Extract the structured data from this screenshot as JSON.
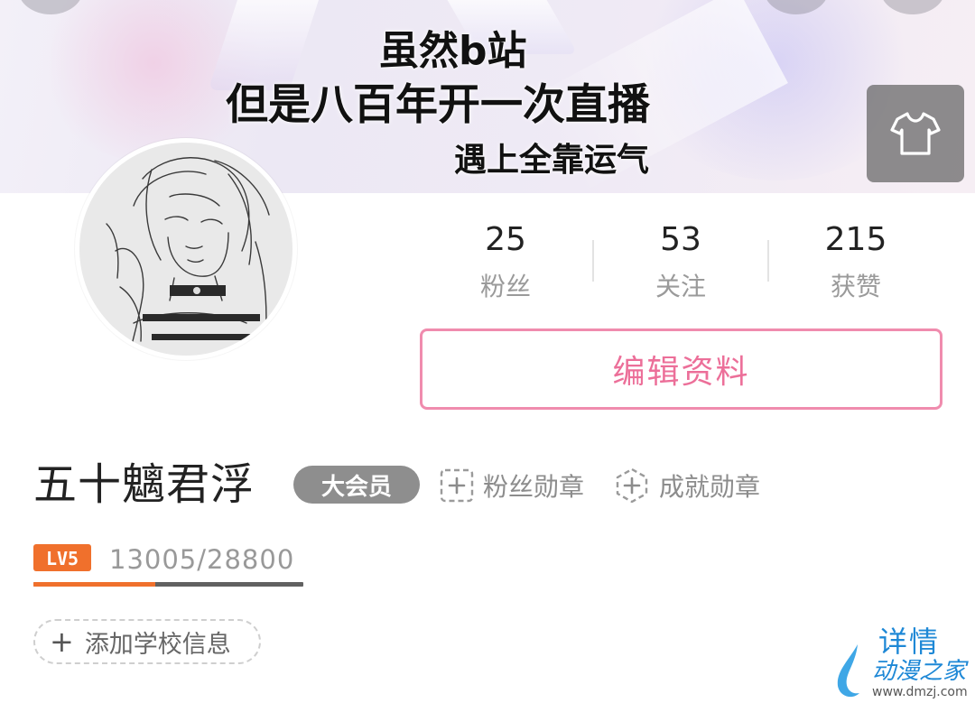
{
  "banner": {
    "lines": [
      "虽然b站",
      "但是八百年开一次直播",
      "遇上全靠运气"
    ],
    "dress_icon": "tshirt-icon"
  },
  "profile": {
    "username": "五十魑君浮",
    "vip_label": "大会员",
    "stats": [
      {
        "value": "25",
        "label": "粉丝"
      },
      {
        "value": "53",
        "label": "关注"
      },
      {
        "value": "215",
        "label": "获赞"
      }
    ],
    "edit_label": "编辑资料",
    "medals": [
      {
        "label": "粉丝勋章",
        "icon": "dashed-plus-square-icon"
      },
      {
        "label": "成就勋章",
        "icon": "dashed-plus-hexagon-icon"
      }
    ],
    "level": {
      "badge": "LV5",
      "exp_text": "13005/28800",
      "progress": 0.4516
    },
    "school_label": "添加学校信息",
    "school_icon": "plus-icon"
  },
  "watermark": {
    "detail": "详情",
    "site": "动漫之家",
    "url": "www.dmzj.com"
  },
  "colors": {
    "accent_pink": "#f08cae",
    "level_orange": "#f0702c",
    "vip_gray": "#8e8e8e",
    "watermark_blue": "#1e88d6"
  }
}
